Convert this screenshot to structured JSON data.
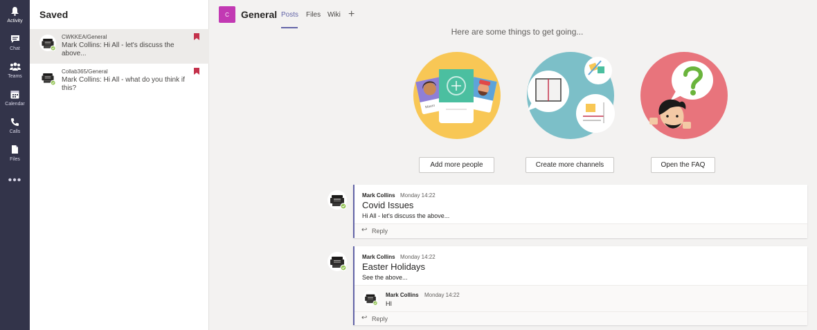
{
  "app_bar": {
    "items": [
      {
        "label": "Activity",
        "icon": "bell-icon"
      },
      {
        "label": "Chat",
        "icon": "chat-icon"
      },
      {
        "label": "Teams",
        "icon": "teams-icon"
      },
      {
        "label": "Calendar",
        "icon": "calendar-icon"
      },
      {
        "label": "Calls",
        "icon": "phone-icon"
      },
      {
        "label": "Files",
        "icon": "file-icon"
      }
    ],
    "more": "•••"
  },
  "saved": {
    "title": "Saved",
    "items": [
      {
        "channel": "CWKKEA/General",
        "message": "Mark Collins: Hi All - let's discuss the above..."
      },
      {
        "channel": "Collab365/General",
        "message": "Mark Collins: Hi All - what do you think if this?"
      }
    ]
  },
  "header": {
    "team_initial": "C",
    "channel": "General",
    "tabs": [
      "Posts",
      "Files",
      "Wiki"
    ],
    "add": "+"
  },
  "welcome": {
    "intro": "Here are some things to get going...",
    "actions": [
      "Add more people",
      "Create more channels",
      "Open the FAQ"
    ],
    "card_name": "Mauro"
  },
  "posts": [
    {
      "author": "Mark Collins",
      "time": "Monday 14:22",
      "subject": "Covid Issues",
      "body": "Hi All - let's discuss the above...",
      "reply": "Reply"
    },
    {
      "author": "Mark Collins",
      "time": "Monday 14:22",
      "subject": "Easter Holidays",
      "body": "See the above...",
      "nested_reply": {
        "author": "Mark Collins",
        "time": "Monday 14:22",
        "body": "HI"
      },
      "reply": "Reply"
    }
  ],
  "colors": {
    "app_bar": "#33344a",
    "accent": "#6264a7",
    "team_tile": "#c239b3",
    "bookmark": "#c4314b",
    "presence": "#92c353"
  }
}
